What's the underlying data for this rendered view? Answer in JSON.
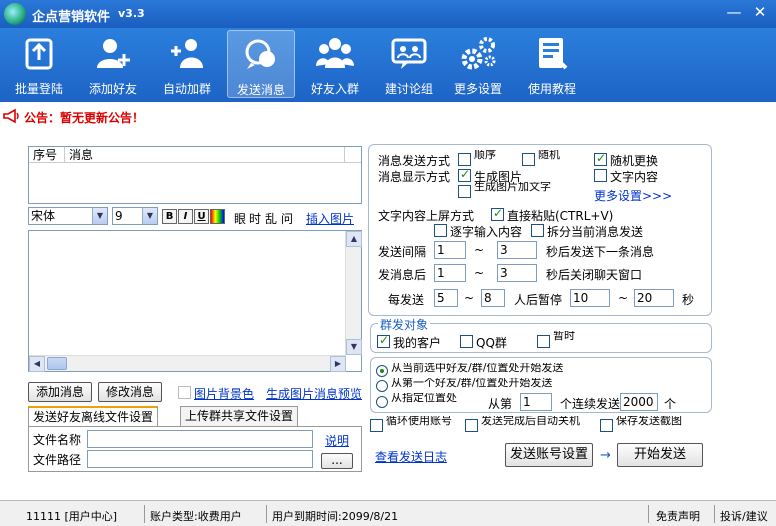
{
  "app": {
    "title": "企点营销软件",
    "version": "v3.3",
    "minimize": "—",
    "close": "✕"
  },
  "toolbar": [
    {
      "label": "批量登陆",
      "icon": "batch-login-icon"
    },
    {
      "label": "添加好友",
      "icon": "add-friend-icon"
    },
    {
      "label": "自动加群",
      "icon": "auto-join-group-icon"
    },
    {
      "label": "发送消息",
      "icon": "send-message-icon",
      "active": true
    },
    {
      "label": "好友入群",
      "icon": "friends-into-group-icon"
    },
    {
      "label": "建讨论组",
      "icon": "discussion-group-icon"
    },
    {
      "label": "更多设置",
      "icon": "settings-gears-icon"
    },
    {
      "label": "使用教程",
      "icon": "tutorial-icon"
    }
  ],
  "notice": {
    "text": "公告：暂无更新公告！"
  },
  "message_table": {
    "col_index": "序号",
    "col_message": "消息"
  },
  "editor": {
    "font": "宋体",
    "size": "9",
    "bold": "B",
    "italic": "I",
    "underline": "U",
    "tool_rand1": "眼",
    "tool_rand2": "时",
    "tool_rand3": "乱",
    "tool_rand4": "问",
    "insert_image": "插入图片"
  },
  "actions": {
    "add_message": "添加消息",
    "edit_message": "修改消息",
    "image_bg": "图片背景色",
    "preview": "生成图片消息预览"
  },
  "file_tabs": {
    "tab1": "发送好友离线文件设置",
    "tab2": "上传群共享文件设置",
    "file_name_label": "文件名称",
    "file_path_label": "文件路径",
    "help": "说明",
    "browse": "..."
  },
  "options": {
    "send_mode_label": "消息发送方式",
    "send_mode_opt1": "顺序",
    "send_mode_opt2": "随机",
    "random_change": "随机更换",
    "display_mode_label": "消息显示方式",
    "gen_image": "生成图片",
    "text_content": "文字内容",
    "image_line3": "生成图片加文字",
    "more_settings": "更多设置>>>",
    "screen_mode_label": "文字内容上屏方式",
    "direct_paste": "直接粘贴(CTRL+V)",
    "char_input": "逐字输入内容",
    "split_send": "拆分当前消息发送",
    "interval_label": "发送间隔",
    "interval_min": "1",
    "interval_max": "3",
    "interval_suffix": "秒后发送下一条消息",
    "close_label": "发消息后",
    "close_min": "1",
    "close_max": "3",
    "close_suffix": "秒后关闭聊天窗口",
    "pause_every": "每发送",
    "pause_min": "5",
    "pause_max": "8",
    "pause_mid": "人后暂停",
    "pause_sec_min": "10",
    "pause_sec_max": "20",
    "pause_unit": "秒",
    "tilde": "~"
  },
  "targets": {
    "title": "群发对象",
    "my_customers": "我的客户",
    "qq_group": "QQ群",
    "temp": "暂时"
  },
  "start_options": {
    "r1": "从当前选中好友/群/位置处开始发送",
    "r2": "从第一个好友/群/位置处开始发送",
    "r3": "从指定位置处",
    "from": "从第",
    "from_val": "1",
    "continuous": "个连续发送",
    "count_val": "2000",
    "unit": "个"
  },
  "bottom_options": {
    "loop": "循环使用账号",
    "auto_shutdown": "发送完成后自动关机",
    "save_log": "保存发送截图"
  },
  "footer_actions": {
    "view_log": "查看发送日志",
    "account_settings": "发送账号设置",
    "arrow": "→",
    "start": "开始发送"
  },
  "status": {
    "user": "11111 [用户中心]",
    "account_type": "账户类型:收费用户",
    "expiry": "用户到期时间:2099/8/21",
    "disclaimer": "免责声明",
    "feedback": "投诉/建议"
  }
}
